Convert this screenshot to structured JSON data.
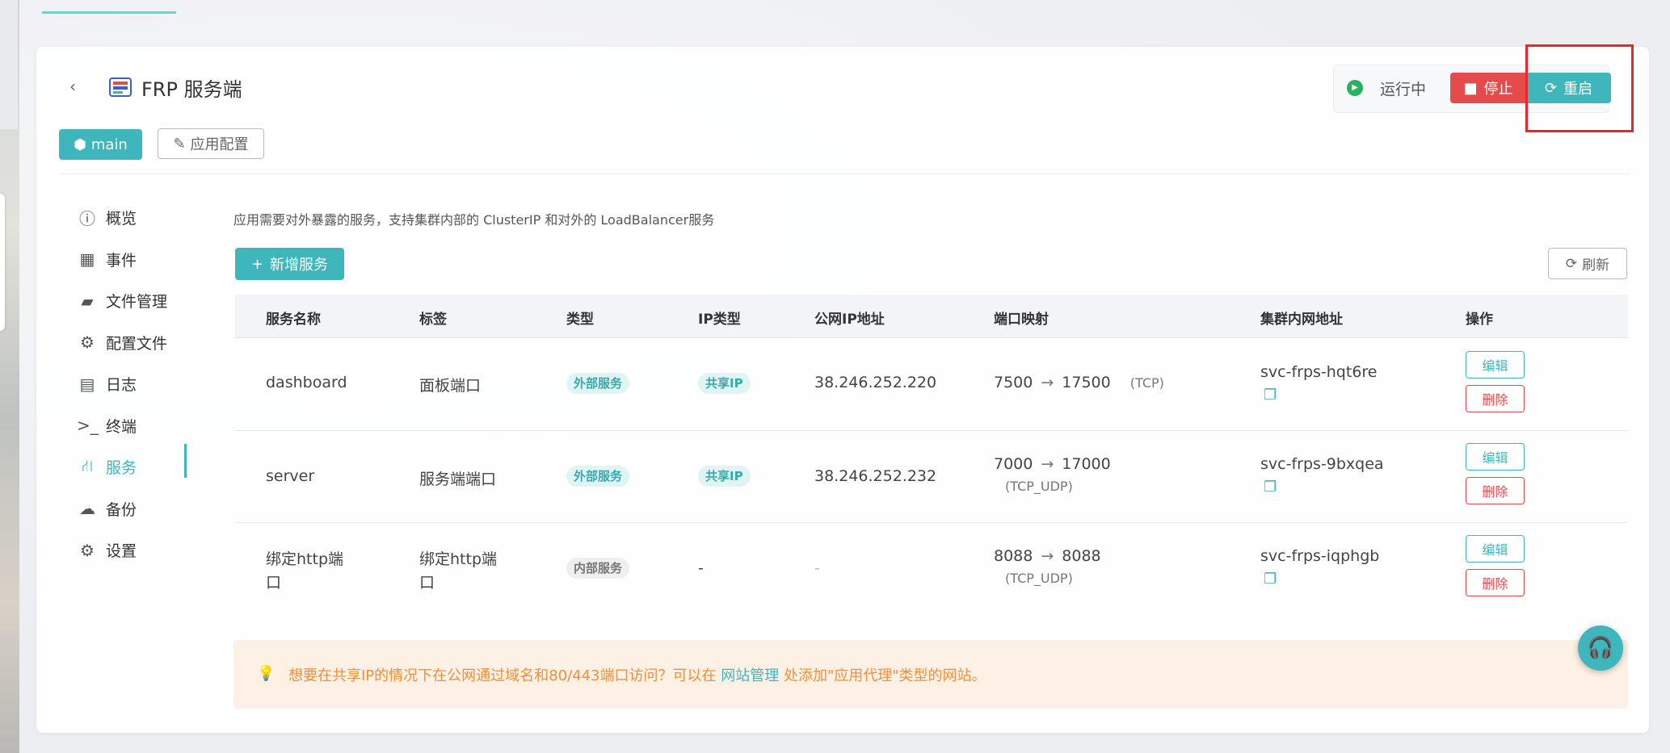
{
  "header": {
    "title": "FRP 服务端",
    "status": "运行中",
    "stop_label": "停止",
    "restart_label": "重启",
    "branch_label": "main",
    "config_label": "应用配置"
  },
  "sidebar": {
    "items": [
      {
        "label": "概览",
        "icon": "info-circle-icon"
      },
      {
        "label": "事件",
        "icon": "calendar-icon"
      },
      {
        "label": "文件管理",
        "icon": "folder-open-icon"
      },
      {
        "label": "配置文件",
        "icon": "gears-icon"
      },
      {
        "label": "日志",
        "icon": "file-text-icon"
      },
      {
        "label": "终端",
        "icon": "terminal-icon"
      },
      {
        "label": "服务",
        "icon": "share-nodes-icon",
        "active": true
      },
      {
        "label": "备份",
        "icon": "cloud-icon"
      },
      {
        "label": "设置",
        "icon": "gear-icon"
      }
    ]
  },
  "services": {
    "description": "应用需要对外暴露的服务，支持集群内部的 ClusterIP 和对外的 LoadBalancer服务",
    "add_label": "新增服务",
    "refresh_label": "刷新",
    "columns": [
      "服务名称",
      "标签",
      "类型",
      "IP类型",
      "公网IP地址",
      "端口映射",
      "集群内网地址",
      "操作"
    ],
    "rows": [
      {
        "name": "dashboard",
        "label": "面板端口",
        "type": "外部服务",
        "ip_type": "共享IP",
        "public_ip": "38.246.252.220",
        "port_from": "7500",
        "port_to": "17500",
        "proto": "(TCP)",
        "cluster_addr": "svc-frps-hqt6re",
        "edit": "编辑",
        "delete": "删除"
      },
      {
        "name": "server",
        "label": "服务端端口",
        "type": "外部服务",
        "ip_type": "共享IP",
        "public_ip": "38.246.252.232",
        "port_from": "7000",
        "port_to": "17000",
        "proto": "(TCP_UDP)",
        "cluster_addr": "svc-frps-9bxqea",
        "edit": "编辑",
        "delete": "删除"
      },
      {
        "name_line1": "绑定http端",
        "name_line2": "口",
        "label_line1": "绑定http端",
        "label_line2": "口",
        "type": "内部服务",
        "ip_type": "-",
        "public_ip": "-",
        "port_from": "8088",
        "port_to": "8088",
        "proto": "(TCP_UDP)",
        "cluster_addr": "svc-frps-iqphgb",
        "edit": "编辑",
        "delete": "删除"
      }
    ],
    "arrow": "→"
  },
  "notice": {
    "text_before": "想要在共享IP的情况下在公网通过域名和80/443端口访问？可以在 ",
    "link": "网站管理",
    "text_after": " 处添加\"应用代理\"类型的网站。"
  },
  "colors": {
    "accent": "#3fb6bc",
    "danger": "#e64b4b",
    "running": "#29b35c",
    "notice": "#f0903a",
    "highlight_box": "#e8262d"
  }
}
